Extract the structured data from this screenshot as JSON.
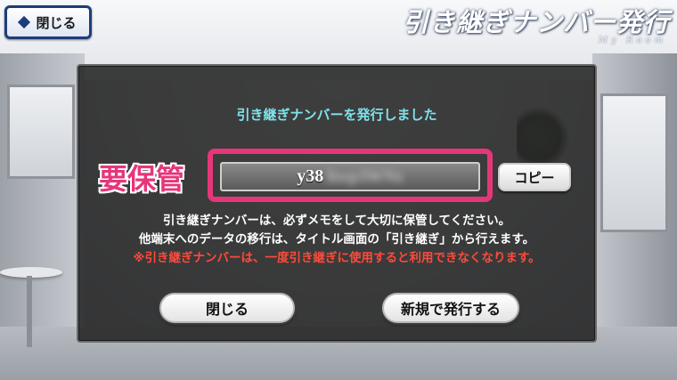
{
  "header": {
    "close_label": "閉じる",
    "title": "引き継ぎナンバー発行",
    "subtitle": "My Room"
  },
  "dialog": {
    "title": "引き継ぎナンバーを発行しました",
    "code_visible": "y38",
    "code_hidden": "hwp3WNz",
    "copy_label": "コピー",
    "note_line1": "引き継ぎナンバーは、必ずメモをして大切に保管してください。",
    "note_line2": "他端末へのデータの移行は、タイトル画面の「引き継ぎ」から行えます。",
    "warning": "※引き継ぎナンバーは、一度引き継ぎに使用すると利用できなくなります。",
    "close_button": "閉じる",
    "reissue_button": "新規で発行する"
  },
  "annotation": {
    "label": "要保管",
    "color": "#e6367a"
  },
  "colors": {
    "title_cyan": "#7fe3ea",
    "warning_red": "#ff4a3a",
    "nav_blue": "#1d3d7a"
  }
}
